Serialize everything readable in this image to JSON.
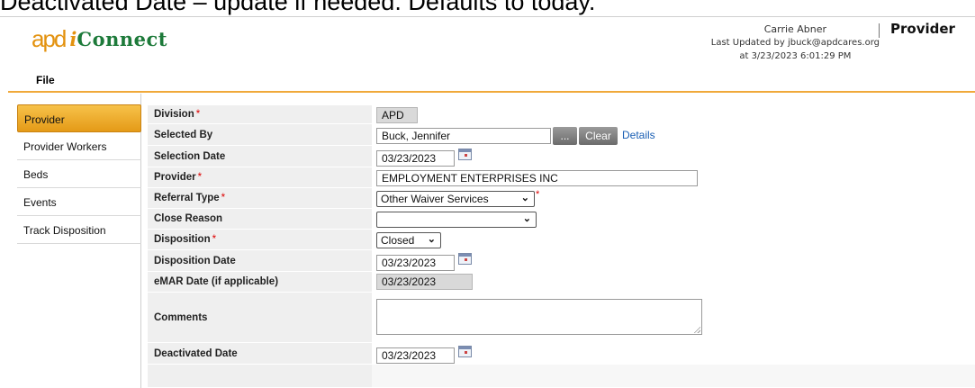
{
  "caption": "Deactivated Date – update if needed. Defaults to today.",
  "app": {
    "logo_mark": "apd",
    "logo_i": "i",
    "logo_text": "Connect"
  },
  "user": {
    "name": "Carrie Abner",
    "updated_by": "Last Updated by jbuck@apdcares.org",
    "updated_at": "at 3/23/2023 6:01:29 PM"
  },
  "page_title": "Provider",
  "menu": {
    "file": "File"
  },
  "sidebar": {
    "items": [
      {
        "label": "Provider",
        "active": true
      },
      {
        "label": "Provider Workers",
        "active": false
      },
      {
        "label": "Beds",
        "active": false
      },
      {
        "label": "Events",
        "active": false
      },
      {
        "label": "Track Disposition",
        "active": false
      }
    ]
  },
  "form": {
    "division": {
      "label": "Division",
      "required": "*",
      "value": "APD"
    },
    "selected_by": {
      "label": "Selected By",
      "value": "Buck, Jennifer",
      "lookup_button": "...",
      "clear_button": "Clear",
      "details_link": "Details"
    },
    "selection_date": {
      "label": "Selection Date",
      "value": "03/23/2023"
    },
    "provider": {
      "label": "Provider",
      "required": "*",
      "value": "EMPLOYMENT ENTERPRISES INC"
    },
    "referral_type": {
      "label": "Referral Type",
      "required": "*",
      "value": "Other Waiver Services",
      "trailing_star": "*"
    },
    "close_reason": {
      "label": "Close Reason",
      "value": ""
    },
    "disposition": {
      "label": "Disposition",
      "required": "*",
      "value": "Closed"
    },
    "disposition_date": {
      "label": "Disposition Date",
      "value": "03/23/2023"
    },
    "emar_date": {
      "label": "eMAR Date (if applicable)",
      "value": "03/23/2023"
    },
    "comments": {
      "label": "Comments",
      "value": ""
    },
    "deactivated_date": {
      "label": "Deactivated Date",
      "value": "03/23/2023"
    }
  },
  "colors": {
    "accent": "#f0a93a",
    "logo_orange": "#e3920f",
    "logo_green": "#1d7a3a",
    "link": "#1a5fb4",
    "required": "#dd0000"
  }
}
